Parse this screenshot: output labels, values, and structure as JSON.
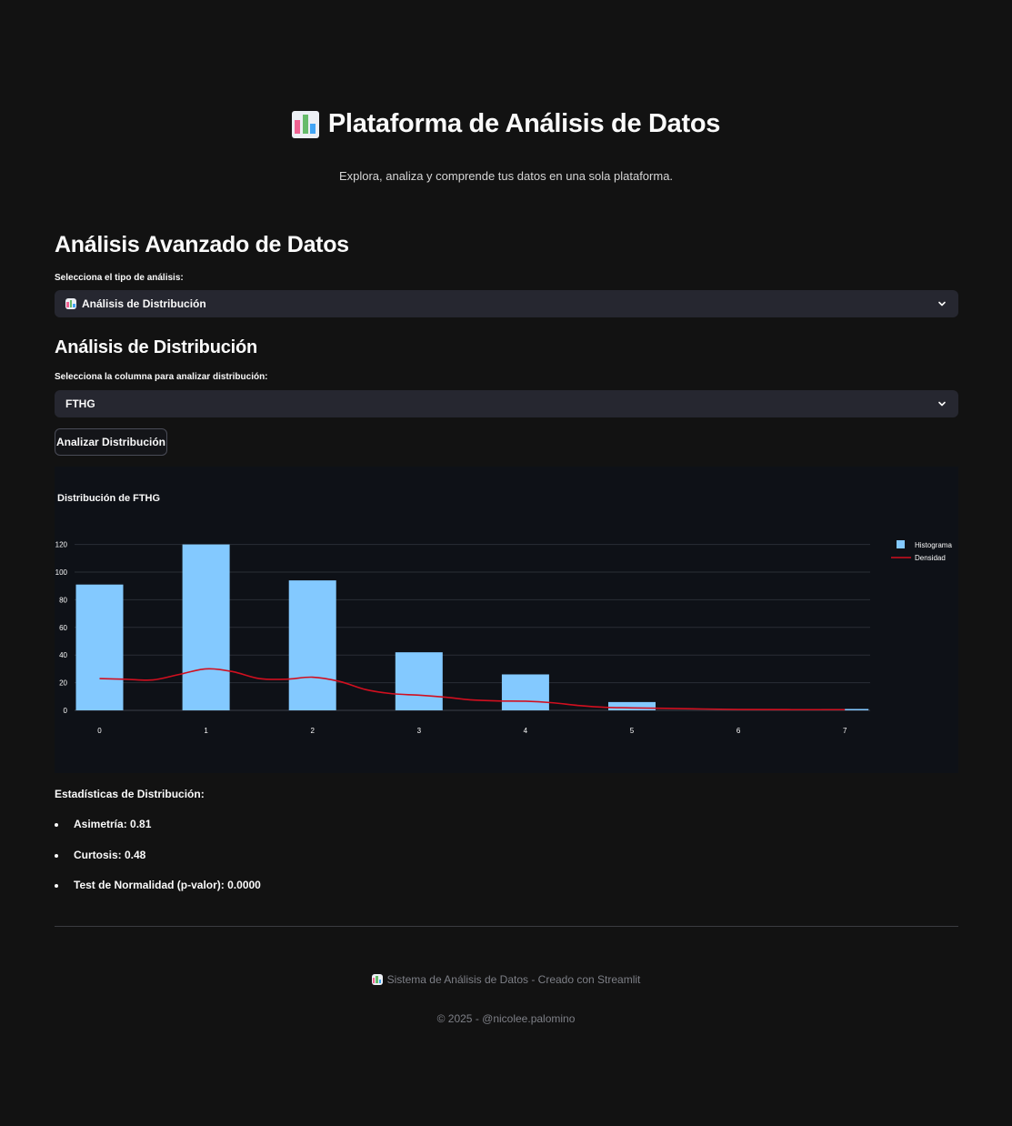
{
  "header": {
    "title": "Plataforma de Análisis de Datos",
    "subtitle": "Explora, analiza y comprende tus datos en una sola plataforma.",
    "icon": "bar-chart-icon"
  },
  "main": {
    "section_title": "Análisis Avanzado de Datos",
    "analysis_type_label": "Selecciona el tipo de análisis:",
    "analysis_type_value": "Análisis de Distribución",
    "subsection_title": "Análisis de Distribución",
    "column_label": "Selecciona la columna para analizar distribución:",
    "column_value": "FTHG",
    "analyze_button": "Analizar Distribución"
  },
  "chart": {
    "background": "#0e1117",
    "histogram_color": "#83c9ff",
    "density_color": "#d10f1f"
  },
  "chart_data": {
    "type": "bar",
    "title": "Distribución de FTHG",
    "xlabel": "",
    "ylabel": "",
    "x_ticks": [
      "0",
      "1",
      "2",
      "3",
      "4",
      "5",
      "6",
      "7"
    ],
    "y_ticks": [
      "0",
      "20",
      "40",
      "60",
      "80",
      "100",
      "120"
    ],
    "ylim": [
      0,
      130
    ],
    "grid": true,
    "legend_position": "top-right",
    "series": [
      {
        "name": "Histograma",
        "type": "bar",
        "x": [
          0,
          1,
          2,
          3,
          4,
          5,
          6,
          7
        ],
        "values": [
          91,
          120,
          94,
          42,
          26,
          6,
          0,
          1
        ]
      },
      {
        "name": "Densidad",
        "type": "line",
        "x": [
          0,
          0.25,
          0.5,
          0.75,
          1,
          1.25,
          1.5,
          1.75,
          2,
          2.25,
          2.5,
          2.75,
          3,
          3.25,
          3.5,
          3.75,
          4,
          4.25,
          4.5,
          4.75,
          5,
          5.5,
          6,
          6.5,
          7
        ],
        "values": [
          23,
          22.5,
          22,
          26,
          30,
          28,
          23,
          22.5,
          24,
          21,
          15,
          12,
          11,
          9.5,
          7.5,
          6.8,
          6.6,
          5.5,
          3.5,
          2.2,
          1.8,
          1.2,
          0.6,
          0.5,
          0.5
        ]
      }
    ]
  },
  "stats": {
    "title": "Estadísticas de Distribución:",
    "items": [
      "Asimetría: 0.81",
      "Curtosis: 0.48",
      "Test de Normalidad (p-valor): 0.0000"
    ]
  },
  "footer": {
    "line1": "Sistema de Análisis de Datos - Creado con Streamlit",
    "line2": "© 2025 - @nicolee.palomino"
  }
}
